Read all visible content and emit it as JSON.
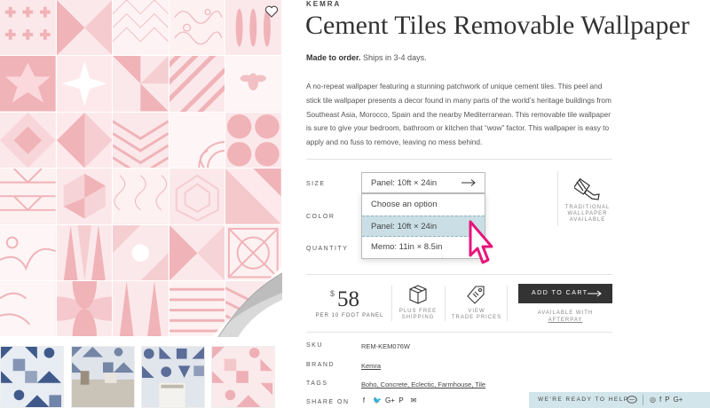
{
  "product": {
    "brand": "KEMRA",
    "title": "Cement Tiles Removable Wallpaper",
    "shipping_strong": "Made to order.",
    "shipping_rest": "Ships in 3-4 days.",
    "description": "A no-repeat wallpaper featuring a stunning patchwork of unique cement tiles. This peel and stick tile wallpaper presents a decor found in many parts of the world’s heritage buildings from Southeast Asia, Morocco, Spain and the nearby Mediterranean. This removable tile wallpaper is sure to give your bedroom, bathroom or kitchen that “wow” factor. This wallpaper is easy to apply and no fuss to remove, leaving no mess behind."
  },
  "options": {
    "size_label": "SIZE",
    "color_label": "COLOR",
    "quantity_label": "QUANTITY",
    "size_selected": "Panel: 10ft × 24in",
    "dropdown": [
      "Choose an option",
      "Panel: 10ft × 24in",
      "Memo: 11in × 8.5in"
    ],
    "dropdown_highlighted": 1,
    "traditional_label": "TRADITIONAL\nWALLPAPER\nAVAILABLE"
  },
  "purchase": {
    "currency": "$",
    "price": "58",
    "price_sub": "PER 10 FOOT PANEL",
    "free_shipping": "PLUS FREE\nSHIPPING",
    "trade_prices": "VIEW\nTRADE PRICES",
    "add_to_cart": "ADD TO CART",
    "afterpay_line": "AVAILABLE WITH",
    "afterpay_link": "AFTERPAY"
  },
  "meta": {
    "sku_label": "SKU",
    "sku": "REM-KEM076W",
    "brand_label": "BRAND",
    "brand": "Kemra",
    "tags_label": "TAGS",
    "tags": "Boho, Concrete, Eclectic, Farmhouse, Tile",
    "share_label": "SHARE ON",
    "share_icons": [
      "f",
      "🐦",
      "G+",
      "P",
      "✉"
    ]
  },
  "help_bar": {
    "text": "WE'RE READY TO HELP",
    "social": [
      "◎",
      "f",
      "P",
      "G+"
    ]
  },
  "icons": {
    "wishlist": "heart-icon",
    "size_arrow": "arrow-right-icon",
    "traditional": "paintbrush-icon",
    "shipping": "box-icon",
    "trade": "price-tag-icon",
    "chat": "chat-bubble-icon",
    "cursor": "pointer-cursor-icon"
  },
  "colors": {
    "tile_pink": "#f0b3b8",
    "tile_light": "#fbe8ea",
    "dropdown_highlight": "#c9dfe5",
    "help_bar": "#d2e5ea",
    "cart_button": "#333333",
    "cursor": "#e8137b"
  }
}
